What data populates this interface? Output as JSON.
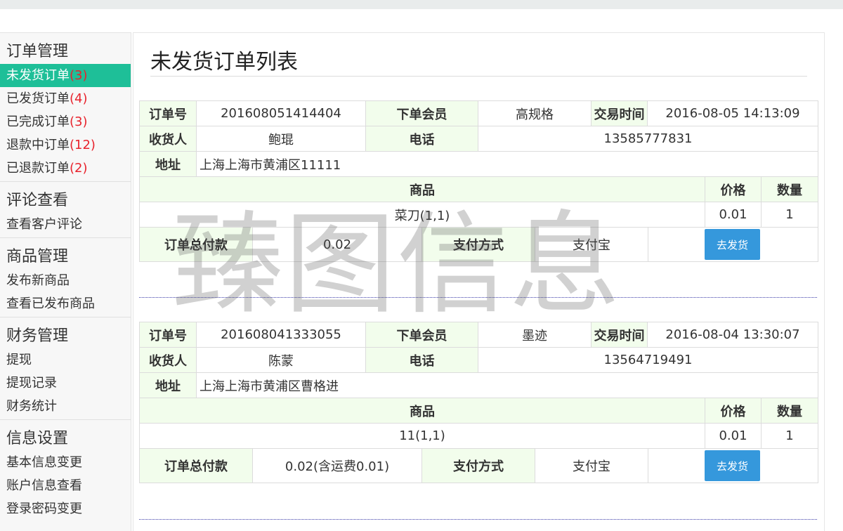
{
  "sidebar": {
    "groups": [
      {
        "title": "订单管理",
        "items": [
          {
            "label": "未发货订单",
            "count": "(3)",
            "active": true
          },
          {
            "label": "已发货订单",
            "count": "(4)"
          },
          {
            "label": "已完成订单",
            "count": "(3)"
          },
          {
            "label": "退款中订单",
            "count": "(12)"
          },
          {
            "label": "已退款订单",
            "count": "(2)"
          }
        ]
      },
      {
        "title": "评论查看",
        "items": [
          {
            "label": "查看客户评论"
          }
        ]
      },
      {
        "title": "商品管理",
        "items": [
          {
            "label": "发布新商品"
          },
          {
            "label": "查看已发布商品"
          }
        ]
      },
      {
        "title": "财务管理",
        "items": [
          {
            "label": "提现"
          },
          {
            "label": "提现记录"
          },
          {
            "label": "财务统计"
          }
        ]
      },
      {
        "title": "信息设置",
        "items": [
          {
            "label": "基本信息变更"
          },
          {
            "label": "账户信息查看"
          },
          {
            "label": "登录密码变更"
          }
        ]
      }
    ]
  },
  "main": {
    "title": "未发货订单列表",
    "labels": {
      "order_no": "订单号",
      "member": "下单会员",
      "time": "交易时间",
      "receiver": "收货人",
      "phone": "电话",
      "address": "地址",
      "product": "商品",
      "price": "价格",
      "qty": "数量",
      "total": "订单总付款",
      "pay_method": "支付方式",
      "ship_button": "去发货"
    },
    "orders": [
      {
        "order_no": "201608051414404",
        "member": "高规格",
        "time": "2016-08-05 14:13:09",
        "receiver": "鲍琨",
        "phone": "13585777831",
        "address": "上海上海市黄浦区11111",
        "product": "菜刀(1,1)",
        "price": "0.01",
        "qty": "1",
        "total": "0.02",
        "pay_method": "支付宝"
      },
      {
        "order_no": "201608041333055",
        "member": "墨迹",
        "time": "2016-08-04 13:30:07",
        "receiver": "陈蒙",
        "phone": "13564719491",
        "address": "上海上海市黄浦区曹格进",
        "product": "11(1,1)",
        "price": "0.01",
        "qty": "1",
        "total": "0.02(含运费0.01)",
        "pay_method": "支付宝"
      }
    ]
  },
  "watermark": "臻图信息",
  "colors": {
    "accent": "#1ebf98",
    "count": "#e8232d",
    "button": "#3598dc",
    "label_bg": "#f2fdec"
  }
}
